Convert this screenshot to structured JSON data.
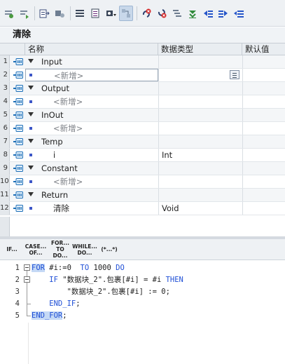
{
  "toolbar": {
    "buttons": [
      {
        "icon": "insert-row-icon"
      },
      {
        "icon": "add-row-icon"
      },
      {
        "icon": "export-icon"
      },
      {
        "icon": "monitor-icon"
      },
      {
        "icon": "list-view-icon"
      },
      {
        "icon": "detail-view-icon"
      },
      {
        "icon": "snapshot-icon"
      },
      {
        "icon": "compare-icon"
      },
      {
        "icon": "call-delete-icon"
      },
      {
        "icon": "call-error-icon"
      },
      {
        "icon": "list-collapse-icon"
      },
      {
        "icon": "download-icon"
      },
      {
        "icon": "indent-left-icon"
      },
      {
        "icon": "indent-right-icon"
      },
      {
        "icon": "outdent-icon"
      }
    ]
  },
  "block_title": "清除",
  "grid": {
    "headers": {
      "name": "名称",
      "type": "数据类型",
      "default": "默认值"
    },
    "rows": [
      {
        "num": "1",
        "kind": "section",
        "name": "Input",
        "type": ""
      },
      {
        "num": "2",
        "kind": "add",
        "name": "<新增>",
        "type": "",
        "editing": true
      },
      {
        "num": "3",
        "kind": "section",
        "name": "Output",
        "type": ""
      },
      {
        "num": "4",
        "kind": "add",
        "name": "<新增>",
        "type": ""
      },
      {
        "num": "5",
        "kind": "section",
        "name": "InOut",
        "type": ""
      },
      {
        "num": "6",
        "kind": "add",
        "name": "<新增>",
        "type": ""
      },
      {
        "num": "7",
        "kind": "section",
        "name": "Temp",
        "type": ""
      },
      {
        "num": "8",
        "kind": "var",
        "name": "i",
        "type": "Int"
      },
      {
        "num": "9",
        "kind": "section",
        "name": "Constant",
        "type": ""
      },
      {
        "num": "10",
        "kind": "add",
        "name": "<新增>",
        "type": ""
      },
      {
        "num": "11",
        "kind": "section",
        "name": "Return",
        "type": ""
      },
      {
        "num": "12",
        "kind": "var",
        "name": "清除",
        "type": "Void"
      }
    ]
  },
  "instructions": [
    {
      "label": "IF..."
    },
    {
      "label": "CASE...\nOF..."
    },
    {
      "label": "FOR...\nTO DO..."
    },
    {
      "label": "WHILE...\nDO..."
    },
    {
      "label": "(*...*)"
    }
  ],
  "code": {
    "line_numbers": [
      "1",
      "2",
      "3",
      "4",
      "5"
    ],
    "lines": [
      {
        "parts": [
          {
            "t": "FOR",
            "c": "kw hl"
          },
          {
            "t": " #i:=0  ",
            "c": ""
          },
          {
            "t": "TO",
            "c": "kw"
          },
          {
            "t": " 1000 ",
            "c": ""
          },
          {
            "t": "DO",
            "c": "kw"
          }
        ]
      },
      {
        "parts": [
          {
            "t": "    IF ",
            "c": "kw"
          },
          {
            "t": "\"数据块_2\".包裹[#i] = #i ",
            "c": ""
          },
          {
            "t": "THEN",
            "c": "kw"
          }
        ]
      },
      {
        "parts": [
          {
            "t": "        \"数据块_2\".包裹[#i] := 0;",
            "c": ""
          }
        ]
      },
      {
        "parts": [
          {
            "t": "    END_IF",
            "c": "kw"
          },
          {
            "t": ";",
            "c": ""
          }
        ]
      },
      {
        "parts": [
          {
            "t": "END_FOR",
            "c": "kw hl"
          },
          {
            "t": ";",
            "c": ""
          }
        ]
      }
    ]
  }
}
